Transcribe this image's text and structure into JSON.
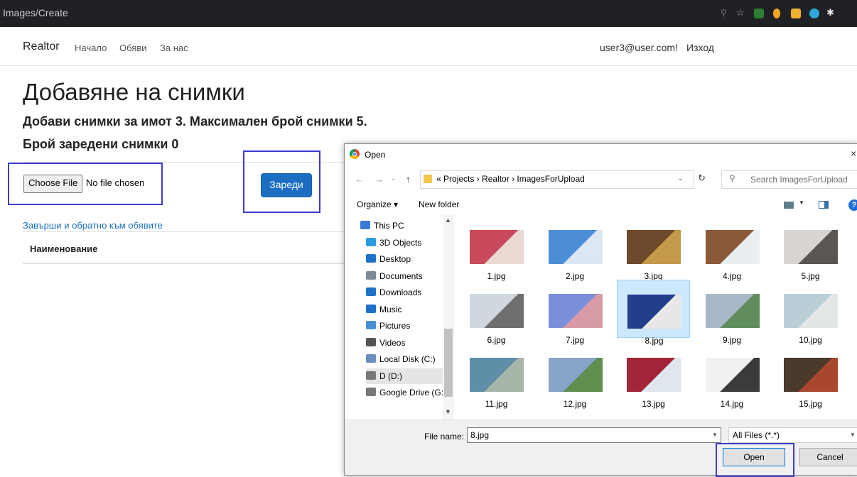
{
  "browser": {
    "tab_title": "Images/Create"
  },
  "navbar": {
    "brand": "Realtor",
    "links": [
      "Начало",
      "Обяви",
      "За нас"
    ],
    "user_email": "user3@user.com!",
    "logout": "Изход"
  },
  "page": {
    "title": "Добавяне на снимки",
    "subtitle": "Добави снимки за имот 3. Максимален брой снимки 5.",
    "uploaded_count": "Брой заредени снимки 0",
    "choose_file_label": "Choose File",
    "no_file_label": "No file chosen",
    "upload_button": "Зареди",
    "finish_link": "Завърши и обратно към обявите",
    "table_headers": [
      "Наименование"
    ]
  },
  "dialog": {
    "title": "Open",
    "breadcrumb": [
      "Projects",
      "Realtor",
      "ImagesForUpload"
    ],
    "search_placeholder": "Search ImagesForUpload",
    "toolbar": {
      "organize": "Organize ▾",
      "new_folder": "New folder"
    },
    "nav_items": [
      {
        "label": "This PC",
        "color": "#3a7bd5",
        "selected": false
      },
      {
        "label": "3D Objects",
        "color": "#2b9be0",
        "selected": false
      },
      {
        "label": "Desktop",
        "color": "#1e73c9",
        "selected": false
      },
      {
        "label": "Documents",
        "color": "#7d8a99",
        "selected": false
      },
      {
        "label": "Downloads",
        "color": "#1e73c9",
        "selected": false
      },
      {
        "label": "Music",
        "color": "#1e73c9",
        "selected": false
      },
      {
        "label": "Pictures",
        "color": "#4a8fd1",
        "selected": false
      },
      {
        "label": "Videos",
        "color": "#555555",
        "selected": false
      },
      {
        "label": "Local Disk (C:)",
        "color": "#6a8fbf",
        "selected": false
      },
      {
        "label": "D (D:)",
        "color": "#777777",
        "selected": true
      },
      {
        "label": "Google Drive (G:",
        "color": "#777777",
        "selected": false
      }
    ],
    "files": [
      {
        "name": "1.jpg",
        "c1": "#c94a5a",
        "c2": "#e8d9d2",
        "selected": false
      },
      {
        "name": "2.jpg",
        "c1": "#4b8ed6",
        "c2": "#dbe8f4",
        "selected": false
      },
      {
        "name": "3.jpg",
        "c1": "#6e4a2c",
        "c2": "#c49a4a",
        "selected": false
      },
      {
        "name": "4.jpg",
        "c1": "#8a5a3a",
        "c2": "#e9eef3",
        "selected": false
      },
      {
        "name": "5.jpg",
        "c1": "#d8d4cf",
        "c2": "#5a5652",
        "selected": false
      },
      {
        "name": "6.jpg",
        "c1": "#cfd8dc",
        "c2": "#6e6e6e",
        "selected": false
      },
      {
        "name": "7.jpg",
        "c1": "#7b8fd8",
        "c2": "#d99aa8",
        "selected": false
      },
      {
        "name": "8.jpg",
        "c1": "#233f8a",
        "c2": "#e7e7e7",
        "selected": true
      },
      {
        "name": "9.jpg",
        "c1": "#a9b8c8",
        "c2": "#5f8d5c",
        "selected": false
      },
      {
        "name": "10.jpg",
        "c1": "#b9cfd8",
        "c2": "#e1e6e6",
        "selected": false
      },
      {
        "name": "11.jpg",
        "c1": "#5f8fa8",
        "c2": "#a6b5a8",
        "selected": false
      },
      {
        "name": "12.jpg",
        "c1": "#88a4c8",
        "c2": "#5f8f4f",
        "selected": false
      },
      {
        "name": "13.jpg",
        "c1": "#a32638",
        "c2": "#dfe6ee",
        "selected": false
      },
      {
        "name": "14.jpg",
        "c1": "#f1f1f1",
        "c2": "#3b3b3b",
        "selected": false
      },
      {
        "name": "15.jpg",
        "c1": "#4a3a2c",
        "c2": "#a9472e",
        "selected": false
      }
    ],
    "filename_label": "File name:",
    "filename_value": "8.jpg",
    "filter_value": "All Files (*.*)",
    "open_button": "Open",
    "cancel_button": "Cancel"
  },
  "colors": {
    "annotation": "#3b3ecc",
    "primary": "#1b6ec2"
  }
}
